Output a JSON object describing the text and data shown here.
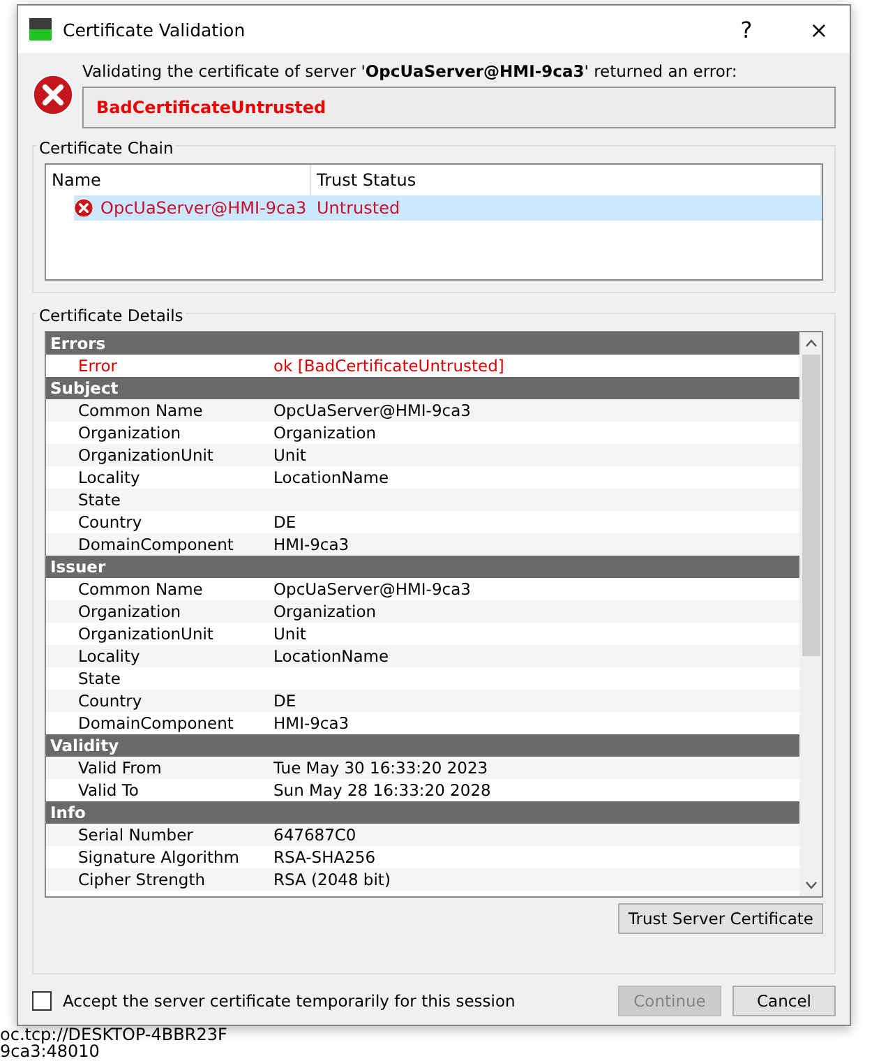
{
  "window": {
    "title": "Certificate Validation",
    "buttons": [
      "?",
      "×"
    ]
  },
  "message": {
    "text": "Validating the certificate of server '**OpcUaServer@HMI-9ca3**' returned an error:",
    "error": "BadCertificateUntrusted"
  },
  "certificate_chain": {
    "title": "Certificate Chain",
    "columns": [
      "Name",
      "Trust Status"
    ],
    "rows": [
      {
        "name": "OpcUaServer@HMI-9ca3",
        "status": "Untrusted",
        "selected": true,
        "kind": "error"
      }
    ]
  },
  "certificate_details": {
    "title": "Certificate Details",
    "sections": [
      {
        "title": "Errors",
        "fields": [
          {
            "label": "Error",
            "value": "ok [BadCertificateUntrusted]",
            "kind": "error"
          }
        ]
      },
      {
        "title": "Subject",
        "fields": [
          {
            "label": "Common Name",
            "value": "OpcUaServer@HMI-9ca3",
            "kind": "normal"
          },
          {
            "label": "Organization",
            "value": "Organization",
            "kind": "normal"
          },
          {
            "label": "OrganizationUnit",
            "value": "Unit",
            "kind": "normal"
          },
          {
            "label": "Locality",
            "value": "LocationName",
            "kind": "normal"
          },
          {
            "label": "State",
            "kind": "normal"
          },
          {
            "label": "Country",
            "value": "DE",
            "kind": "normal"
          },
          {
            "label": "DomainComponent",
            "value": "HMI-9ca3",
            "kind": "normal"
          }
        ]
      },
      {
        "title": "Issuer",
        "fields": [
          {
            "label": "Common Name",
            "value": "OpcUaServer@HMI-9ca3",
            "kind": "normal"
          },
          {
            "label": "Organization",
            "value": "Organization",
            "kind": "normal"
          },
          {
            "label": "OrganizationUnit",
            "value": "Unit",
            "kind": "normal"
          },
          {
            "label": "Locality",
            "value": "LocationName",
            "kind": "normal"
          },
          {
            "label": "State",
            "kind": "normal"
          },
          {
            "label": "Country",
            "value": "DE",
            "kind": "normal"
          },
          {
            "label": "DomainComponent",
            "value": "HMI-9ca3",
            "kind": "normal"
          }
        ]
      },
      {
        "title": "Validity",
        "fields": [
          {
            "label": "Valid From",
            "value": "Tue May 30 16:33:20 2023",
            "kind": "normal"
          },
          {
            "label": "Valid To",
            "value": "Sun May 28 16:33:20 2028",
            "kind": "normal"
          }
        ]
      },
      {
        "title": "Info",
        "fields": [
          {
            "label": "Serial Number",
            "value": "647687C0",
            "kind": "normal"
          },
          {
            "label": "Signature Algorithm",
            "value": "RSA-SHA256",
            "kind": "normal"
          },
          {
            "label": "Cipher Strength",
            "value": "RSA (2048 bit)",
            "kind": "normal"
          }
        ]
      }
    ],
    "trust_button": "Trust Server Certificate"
  },
  "accept_temporarily": {
    "label": "Accept the server certificate temporarily for this session",
    "checked": false
  },
  "buttons": [
    {
      "label": "Continue",
      "disabled": true
    },
    {
      "label": "Cancel",
      "disabled": false
    }
  ],
  "background_text": [
    "oc.tcp://DESKTOP-4BBR23F",
    "9ca3:48010"
  ]
}
